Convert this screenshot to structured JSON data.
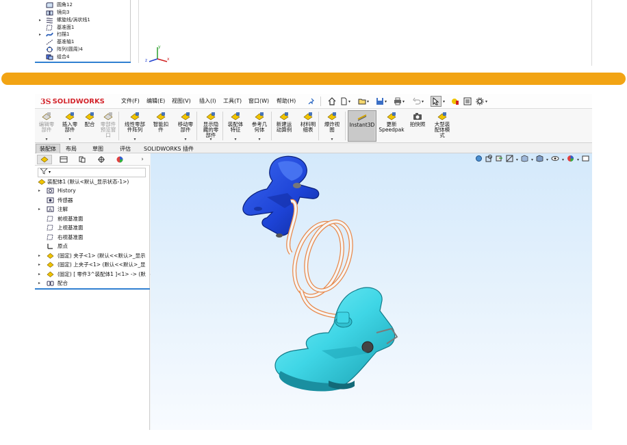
{
  "top_fragment": {
    "tree_items": [
      {
        "label": "圆角12",
        "icon": "fillet-icon"
      },
      {
        "label": "镜向3",
        "icon": "mirror-icon"
      },
      {
        "label": "螺旋线/涡状线1",
        "icon": "helix-icon"
      },
      {
        "label": "基准面1",
        "icon": "plane-icon"
      },
      {
        "label": "扫描1",
        "icon": "sweep-icon"
      },
      {
        "label": "基准轴1",
        "icon": "axis-icon"
      },
      {
        "label": "阵列(圆周)4",
        "icon": "circular-pattern-icon"
      },
      {
        "label": "组合4",
        "icon": "combine-icon"
      }
    ]
  },
  "separator_color": "#f2a414",
  "window": {
    "logo": {
      "mark": "3S",
      "brand": "SOLIDWORKS"
    },
    "menus": [
      "文件(F)",
      "编辑(E)",
      "视图(V)",
      "插入(I)",
      "工具(T)",
      "窗口(W)",
      "帮助(H)"
    ],
    "ribbon": [
      {
        "label": "编辑零\n部件",
        "disabled": true,
        "icon": "edit-component-icon"
      },
      {
        "label": "插入零\n部件",
        "disabled": false,
        "icon": "insert-component-icon"
      },
      {
        "label": "配合",
        "disabled": false,
        "icon": "mate-icon"
      },
      {
        "label": "零部件\n预览窗\n口",
        "disabled": true,
        "icon": "component-preview-icon"
      },
      {
        "label": "线性零部\n件阵列",
        "disabled": false,
        "icon": "linear-pattern-icon"
      },
      {
        "label": "智能扣\n件",
        "disabled": false,
        "icon": "smart-fasteners-icon"
      },
      {
        "label": "移动零\n部件",
        "disabled": false,
        "icon": "move-component-icon"
      },
      {
        "label": "显示隐\n藏的零\n部件",
        "disabled": false,
        "icon": "show-hidden-icon"
      },
      {
        "label": "装配体\n特征",
        "disabled": false,
        "icon": "assembly-features-icon"
      },
      {
        "label": "参考几\n何体",
        "disabled": false,
        "icon": "reference-geometry-icon"
      },
      {
        "label": "新建运\n动算例",
        "disabled": false,
        "icon": "motion-study-icon"
      },
      {
        "label": "材料明\n细表",
        "disabled": false,
        "icon": "bom-icon"
      },
      {
        "label": "爆炸视\n图",
        "disabled": false,
        "icon": "exploded-view-icon"
      },
      {
        "label": "Instant3D",
        "disabled": false,
        "active": true,
        "icon": "instant3d-icon"
      },
      {
        "label": "更新\nSpeedpak",
        "disabled": false,
        "icon": "speedpak-icon"
      },
      {
        "label": "拍快照",
        "disabled": false,
        "icon": "snapshot-icon"
      },
      {
        "label": "大型装\n配体模\n式",
        "disabled": false,
        "icon": "large-assembly-icon"
      }
    ],
    "tabs": [
      "装配体",
      "布局",
      "草图",
      "评估",
      "SOLIDWORKS 插件"
    ],
    "active_tab": "装配体",
    "feature_tree": {
      "root": "装配体1 (默认<默认_显示状态-1>)",
      "items": [
        {
          "label": "History",
          "expand": true,
          "icon": "history-icon"
        },
        {
          "label": "传感器",
          "expand": false,
          "icon": "sensor-icon"
        },
        {
          "label": "注解",
          "expand": true,
          "icon": "annotations-icon"
        },
        {
          "label": "前视基准面",
          "expand": false,
          "icon": "plane-icon"
        },
        {
          "label": "上视基准面",
          "expand": false,
          "icon": "plane-icon"
        },
        {
          "label": "右视基准面",
          "expand": false,
          "icon": "plane-icon"
        },
        {
          "label": "原点",
          "expand": false,
          "icon": "origin-icon"
        },
        {
          "label": "(固定) 夹子<1> (默认<<默认>_显示",
          "expand": true,
          "icon": "part-icon"
        },
        {
          "label": "(固定) 上夹子<1> (默认<<默认>_显",
          "expand": true,
          "icon": "part-icon"
        },
        {
          "label": "(固定) [ 零件3^装配体1 ]<1> -> (默",
          "expand": true,
          "icon": "part-icon"
        },
        {
          "label": "配合",
          "expand": true,
          "icon": "mates-icon"
        }
      ]
    },
    "colors": {
      "upper_clip": "#1d43d6",
      "lower_clip": "#3fd6e6",
      "spring_outline": "#e8884a",
      "viewport_top": "#d4e9fb"
    }
  }
}
